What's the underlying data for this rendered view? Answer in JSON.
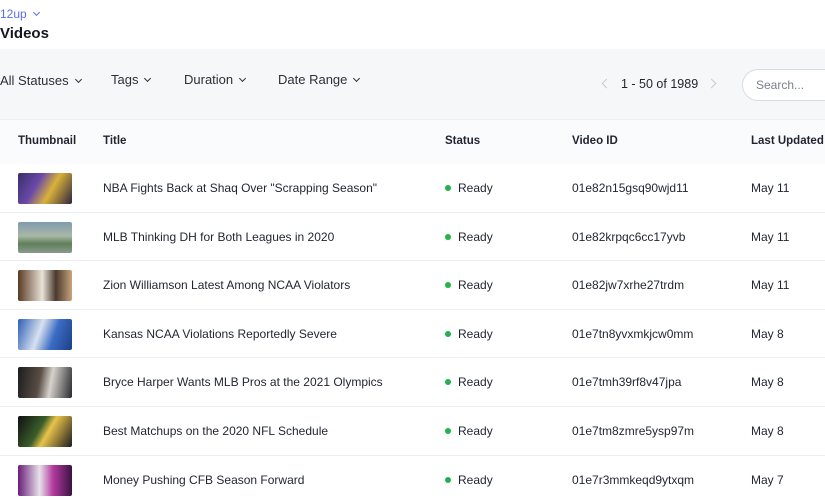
{
  "org": {
    "name": "12up"
  },
  "page": {
    "title": "Videos"
  },
  "filters": {
    "status": "All Statuses",
    "tags": "Tags",
    "duration": "Duration",
    "date_range": "Date Range"
  },
  "pagination": {
    "range": "1 - 50 of 1989"
  },
  "search": {
    "placeholder": "Search..."
  },
  "table": {
    "columns": {
      "thumbnail": "Thumbnail",
      "title": "Title",
      "status": "Status",
      "video_id": "Video ID",
      "last_updated": "Last Updated"
    },
    "rows": [
      {
        "title": "NBA Fights Back at Shaq Over \"Scrapping Season\"",
        "status": "Ready",
        "video_id": "01e82n15gsq90wjd11",
        "updated": "May 11"
      },
      {
        "title": "MLB Thinking DH for Both Leagues in 2020",
        "status": "Ready",
        "video_id": "01e82krpqc6cc17yvb",
        "updated": "May 11"
      },
      {
        "title": "Zion Williamson Latest Among NCAA Violators",
        "status": "Ready",
        "video_id": "01e82jw7xrhe27trdm",
        "updated": "May 11"
      },
      {
        "title": "Kansas NCAA Violations Reportedly Severe",
        "status": "Ready",
        "video_id": "01e7tn8yvxmkjcw0mm",
        "updated": "May 8"
      },
      {
        "title": "Bryce Harper Wants MLB Pros at the 2021 Olympics",
        "status": "Ready",
        "video_id": "01e7tmh39rf8v47jpa",
        "updated": "May 8"
      },
      {
        "title": "Best Matchups on the 2020 NFL Schedule",
        "status": "Ready",
        "video_id": "01e7tm8zmre5ysp97m",
        "updated": "May 8"
      },
      {
        "title": "Money Pushing CFB Season Forward",
        "status": "Ready",
        "video_id": "01e7r3mmkeqd9ytxqm",
        "updated": "May 7"
      }
    ]
  },
  "colors": {
    "accent": "#5a6cf0",
    "status_ready": "#22b24c"
  }
}
